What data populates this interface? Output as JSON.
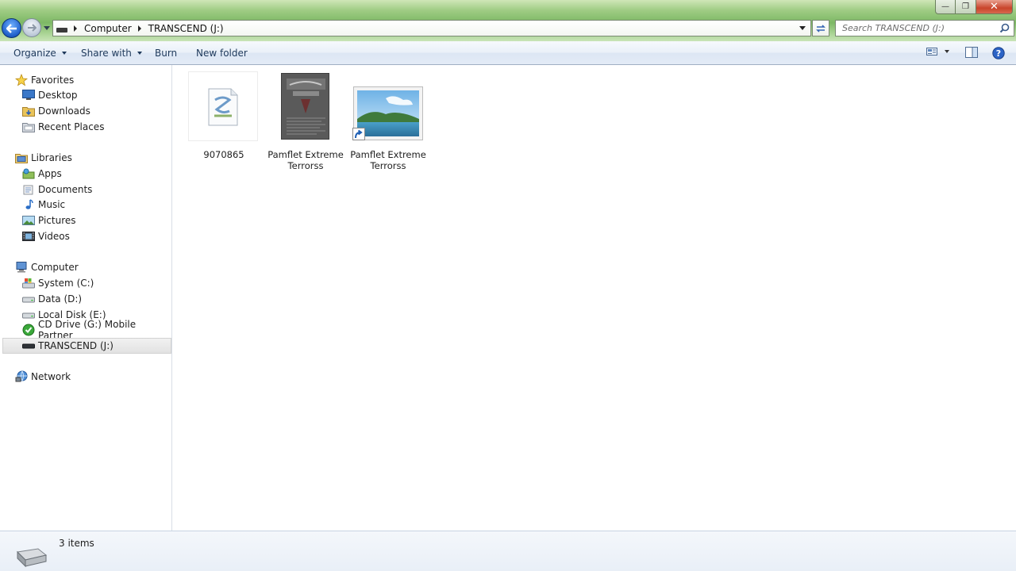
{
  "window": {
    "min": "—",
    "max": "❐",
    "close": "✕"
  },
  "address": {
    "breadcrumbs": [
      "Computer",
      "TRANSCEND (J:)"
    ]
  },
  "search": {
    "placeholder": "Search TRANSCEND (J:)"
  },
  "toolbar": {
    "organize": "Organize",
    "share_with": "Share with",
    "burn": "Burn",
    "new_folder": "New folder"
  },
  "nav": {
    "favorites": {
      "label": "Favorites",
      "items": [
        "Desktop",
        "Downloads",
        "Recent Places"
      ]
    },
    "libraries": {
      "label": "Libraries",
      "items": [
        "Apps",
        "Documents",
        "Music",
        "Pictures",
        "Videos"
      ]
    },
    "computer": {
      "label": "Computer",
      "items": [
        "System (C:)",
        "Data (D:)",
        "Local Disk (E:)",
        "CD Drive (G:) Mobile Partner",
        "TRANSCEND (J:)"
      ],
      "selected": "TRANSCEND (J:)"
    },
    "network": {
      "label": "Network"
    }
  },
  "files": [
    {
      "name": "9070865",
      "kind": "document"
    },
    {
      "name_line1": "Pamflet Extreme",
      "name_line2": "Terrorss",
      "kind": "image"
    },
    {
      "name_line1": "Pamflet Extreme",
      "name_line2": "Terrorss",
      "kind": "shortcut"
    }
  ],
  "status": {
    "item_count": "3 items"
  }
}
